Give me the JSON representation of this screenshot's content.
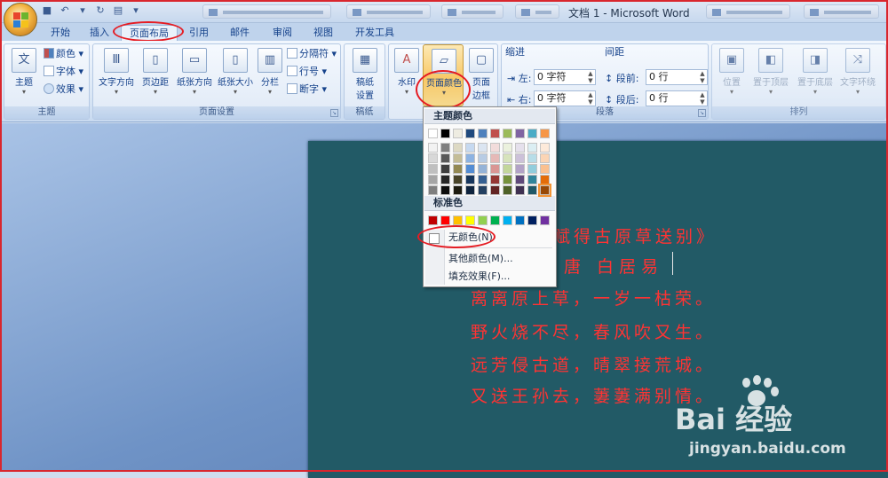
{
  "window": {
    "title": "文档 1 - Microsoft Word"
  },
  "tabs": [
    "开始",
    "插入",
    "页面布局",
    "引用",
    "邮件",
    "审阅",
    "视图",
    "开发工具"
  ],
  "active_tab": "页面布局",
  "groups": {
    "theme": {
      "label": "主题",
      "buttons": {
        "theme": "主题",
        "colors": "颜色",
        "fonts": "字体",
        "effects": "效果"
      }
    },
    "page_setup": {
      "label": "页面设置",
      "buttons": {
        "text_direction": "文字方向",
        "margins": "页边距",
        "orientation": "纸张方向",
        "size": "纸张大小",
        "columns": "分栏",
        "breaks": "分隔符",
        "line_numbers": "行号",
        "hyphenation": "断字"
      }
    },
    "manuscript": {
      "label": "稿纸",
      "buttons": {
        "manuscript_settings_1": "稿纸",
        "manuscript_settings_2": "设置"
      }
    },
    "page_background": {
      "buttons": {
        "watermark": "水印",
        "page_color": "页面颜色",
        "page_borders_1": "页面",
        "page_borders_2": "边框"
      }
    },
    "paragraph": {
      "label": "段落",
      "indent_title": "缩进",
      "spacing_title": "间距",
      "indent_left_label": "左:",
      "indent_left_value": "0 字符",
      "indent_right_label": "右:",
      "indent_right_value": "0 字符",
      "spacing_before_label": "段前:",
      "spacing_before_value": "0 行",
      "spacing_after_label": "段后:",
      "spacing_after_value": "0 行"
    },
    "arrange": {
      "label": "排列",
      "buttons": {
        "position": "位置",
        "bring_front": "置于顶层",
        "send_back": "置于底层",
        "text_wrap": "文字环绕"
      }
    }
  },
  "dropdown": {
    "theme_colors_header": "主题颜色",
    "standard_colors_header": "标准色",
    "no_color": "无颜色(N)",
    "more_colors": "其他颜色(M)...",
    "fill_effects": "填充效果(F)...",
    "theme_top_row": [
      "#ffffff",
      "#000000",
      "#eeece1",
      "#1f497d",
      "#4f81bd",
      "#c0504d",
      "#9bbb59",
      "#8064a2",
      "#4bacc6",
      "#f79646"
    ],
    "theme_shades": [
      [
        "#f2f2f2",
        "#7f7f7f",
        "#ddd9c3",
        "#c6d9f0",
        "#dbe5f1",
        "#f2dcdb",
        "#ebf1dd",
        "#e5e0ec",
        "#dbeef3",
        "#fdeada"
      ],
      [
        "#d8d8d8",
        "#595959",
        "#c4bd97",
        "#8db3e2",
        "#b8cce4",
        "#e5b9b7",
        "#d7e3bc",
        "#ccc1d9",
        "#b7dde8",
        "#fbd5b5"
      ],
      [
        "#bfbfbf",
        "#3f3f3f",
        "#938953",
        "#548dd4",
        "#95b3d7",
        "#d99694",
        "#c3d69b",
        "#b2a2c7",
        "#92cddc",
        "#fac08f"
      ],
      [
        "#a5a5a5",
        "#262626",
        "#494429",
        "#17365d",
        "#366092",
        "#953734",
        "#76923c",
        "#5f497a",
        "#31859b",
        "#e36c09"
      ],
      [
        "#7f7f7f",
        "#0c0c0c",
        "#1d1b10",
        "#0f243e",
        "#244061",
        "#632423",
        "#4f6128",
        "#3f3151",
        "#205867",
        "#974806"
      ]
    ],
    "standard": [
      "#c00000",
      "#ff0000",
      "#ffc000",
      "#ffff00",
      "#92d050",
      "#00b050",
      "#00b0f0",
      "#0070c0",
      "#002060",
      "#7030a0"
    ]
  },
  "document": {
    "lines": [
      "《赋得古原草送别》",
      "唐  白居易",
      "离离原上草，一岁一枯荣。",
      "野火烧不尽，春风吹又生。",
      "远芳侵古道，晴翠接荒城。",
      "又送王孙去，萋萋满别情。"
    ],
    "page_color": "#225a66",
    "text_color": "#ff3333"
  },
  "watermark": {
    "brand": "Bai  经验",
    "url": "jingyan.baidu.com"
  }
}
